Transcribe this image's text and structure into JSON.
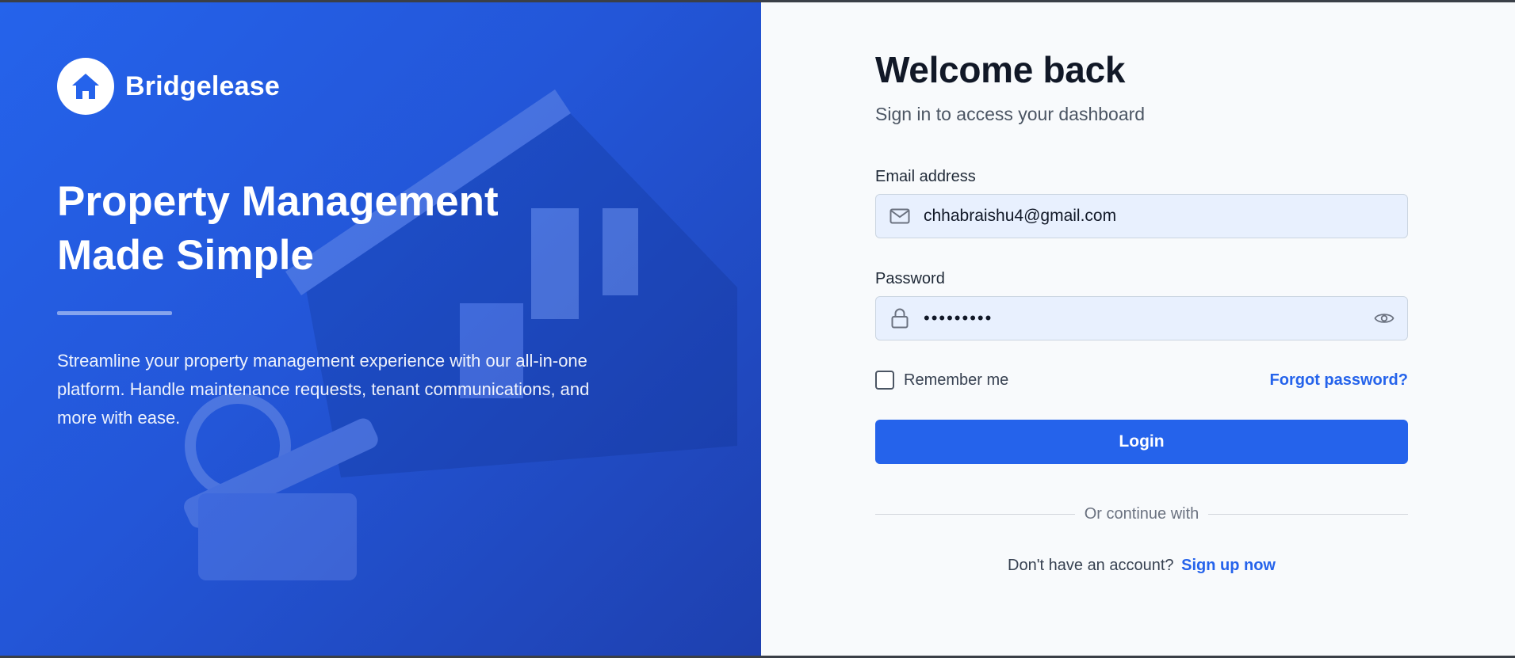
{
  "brand": {
    "name": "Bridgelease",
    "logo_icon": "house-icon"
  },
  "hero": {
    "title": "Property Management Made Simple",
    "description": "Streamline your property management experience with our all-in-one platform. Handle maintenance requests, tenant communications, and more with ease."
  },
  "form": {
    "title": "Welcome back",
    "subtitle": "Sign in to access your dashboard",
    "email_label": "Email address",
    "email_value": "chhabraishu4@gmail.com",
    "password_label": "Password",
    "password_value": "•••••••••",
    "remember_label": "Remember me",
    "forgot_label": "Forgot password?",
    "login_label": "Login",
    "divider_text": "Or continue with",
    "signup_prompt": "Don't have an account?",
    "signup_link": "Sign up now"
  },
  "colors": {
    "accent": "#2563eb",
    "hero_dark": "#1e40af",
    "panel_bg": "#f8fafc",
    "field_bg": "#e8f0fe"
  }
}
